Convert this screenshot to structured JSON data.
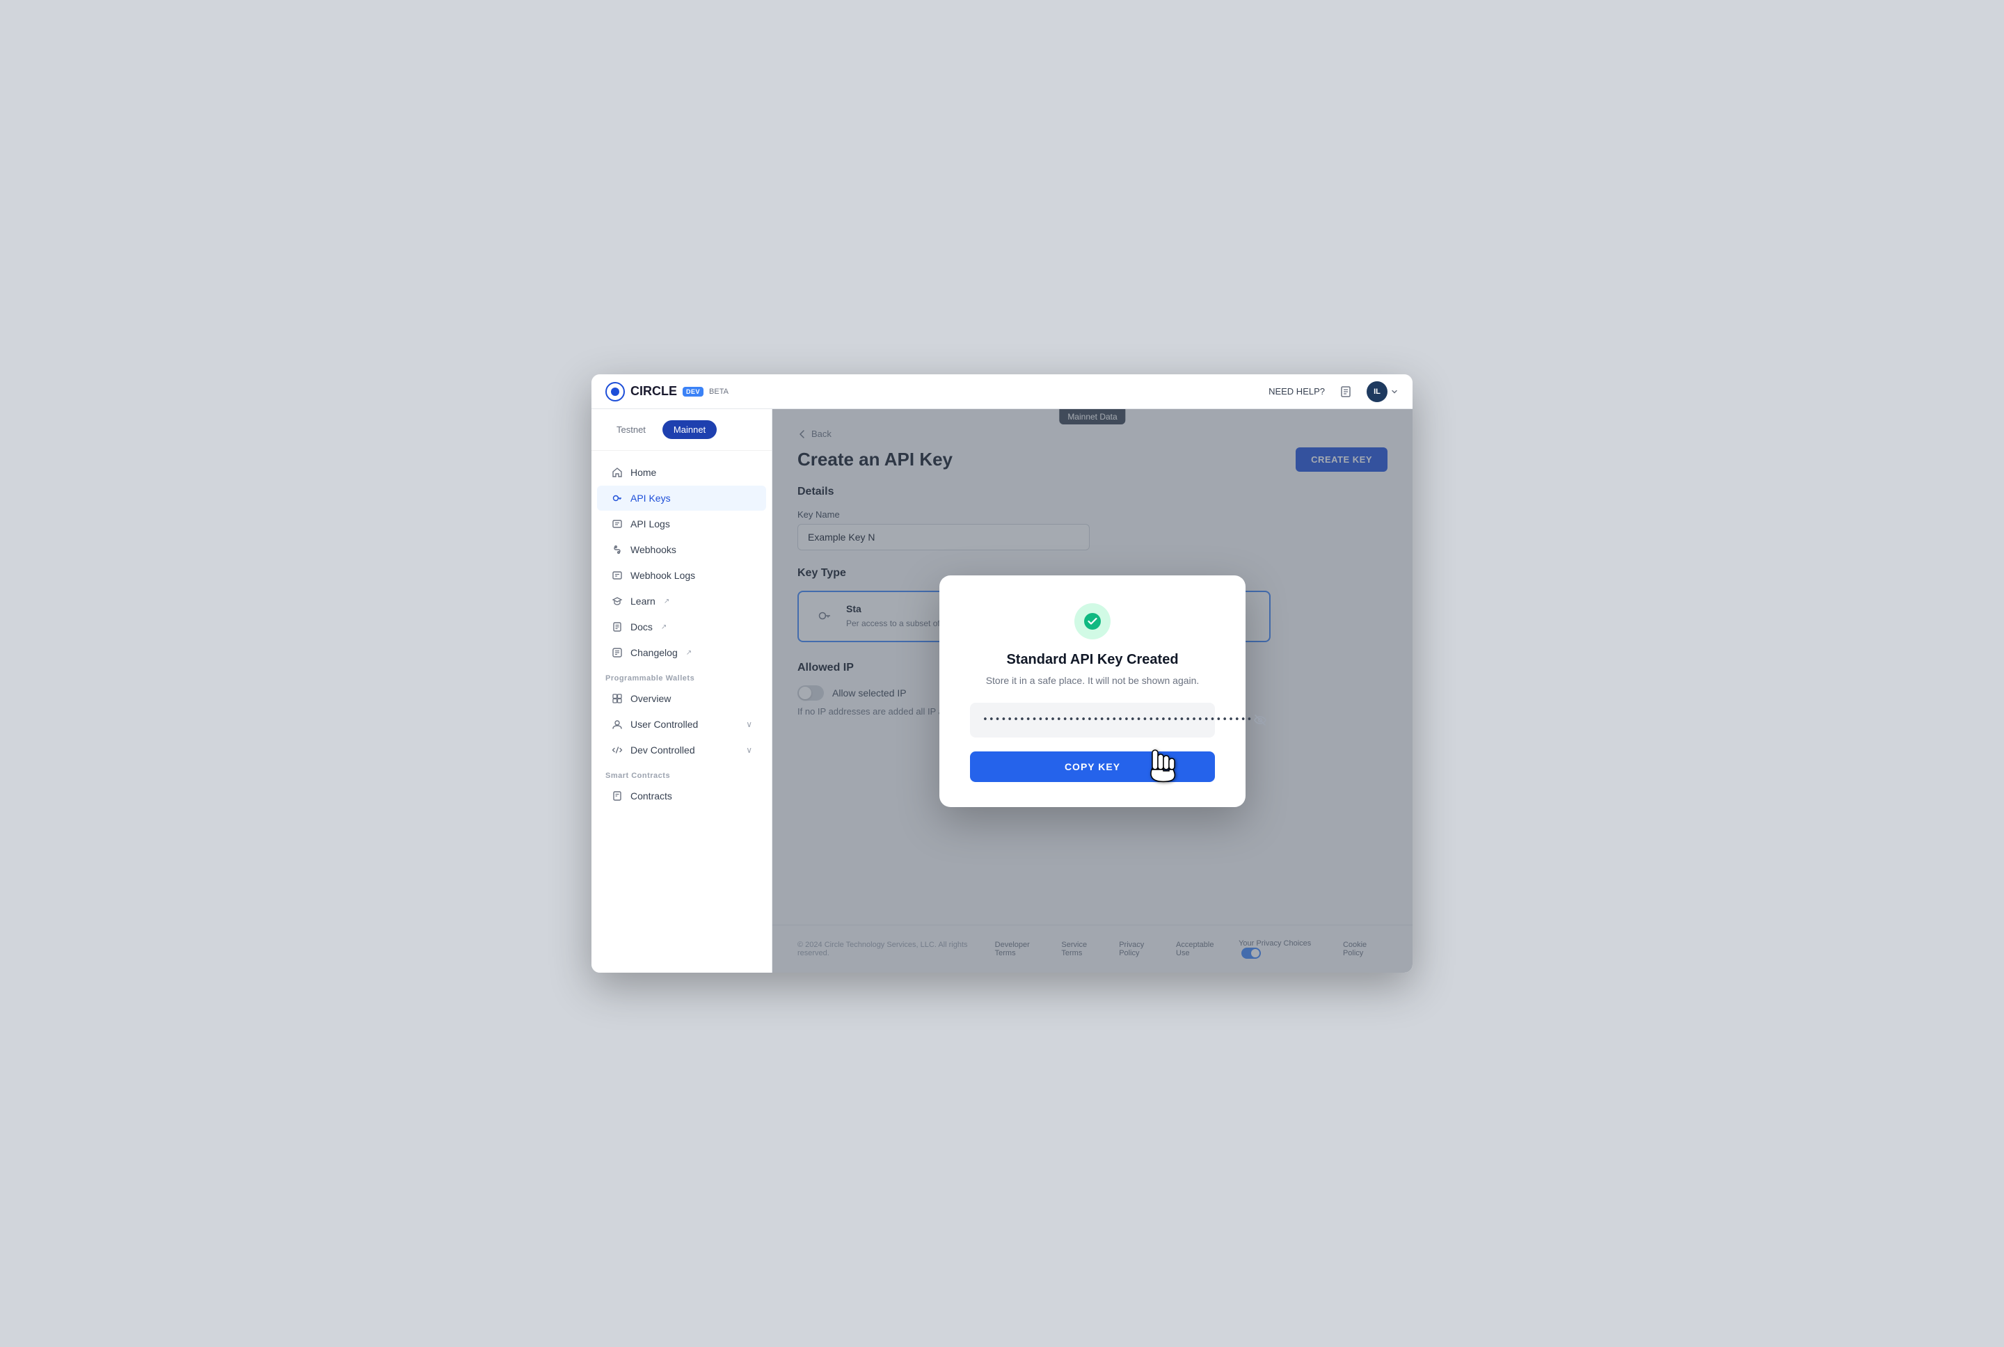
{
  "app": {
    "title": "CIRCLE",
    "dev_badge": "DEV",
    "beta_badge": "BETA",
    "need_help": "NEED HELP?",
    "user_initials": "IL"
  },
  "network": {
    "testnet_label": "Testnet",
    "mainnet_label": "Mainnet",
    "mainnet_banner": "Mainnet Data"
  },
  "sidebar": {
    "home_label": "Home",
    "api_keys_label": "API Keys",
    "api_logs_label": "API Logs",
    "webhooks_label": "Webhooks",
    "webhook_logs_label": "Webhook Logs",
    "learn_label": "Learn",
    "docs_label": "Docs",
    "changelog_label": "Changelog",
    "programmable_wallets_label": "Programmable Wallets",
    "overview_label": "Overview",
    "user_controlled_label": "User Controlled",
    "dev_controlled_label": "Dev Controlled",
    "smart_contracts_label": "Smart Contracts",
    "contracts_label": "Contracts"
  },
  "page": {
    "back_label": "Back",
    "title": "Create an API Key",
    "create_key_btn": "CREATE KEY"
  },
  "details_section": {
    "title": "Details",
    "key_name_label": "Key Name",
    "key_name_value": "Example Key N",
    "key_name_placeholder": "Example Key N"
  },
  "key_type_section": {
    "title": "Key Type",
    "card_title": "Sta",
    "card_desc": "Per access to a subset of APIs. For example, acc read-only access to User Controlled Wallets"
  },
  "allowed_ip_section": {
    "title": "Allowed IP",
    "toggle_label": "Allow selected IP",
    "hint": "If no IP addresses are added all IP addresses are reachable."
  },
  "modal": {
    "success_title": "Standard API Key Created",
    "success_subtitle": "Store it in a safe place. It will not be shown again.",
    "key_masked": "••••••••••••••••••••••••••••••••••••••••••••",
    "copy_btn_label": "COPY KEY"
  },
  "footer": {
    "copyright": "© 2024 Circle Technology Services, LLC. All rights reserved.",
    "links": [
      "Developer Terms",
      "Service Terms",
      "Privacy Policy",
      "Acceptable Use",
      "Your Privacy Choices",
      "Cookie Policy"
    ]
  }
}
